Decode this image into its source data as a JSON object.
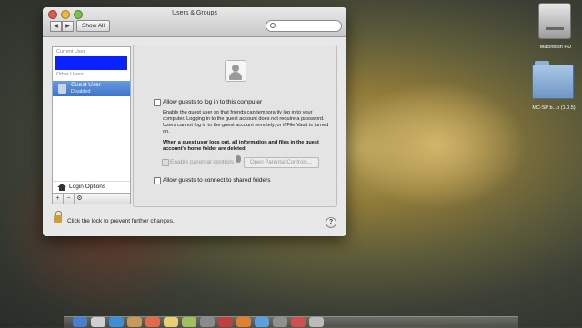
{
  "window": {
    "title": "Users & Groups",
    "show_all": "Show All",
    "search_placeholder": ""
  },
  "sidebar": {
    "current_user_header": "Current User",
    "other_users_header": "Other Users",
    "guest_user": {
      "name": "Guest User",
      "status": "Disabled"
    },
    "login_options": "Login Options",
    "add_symbol": "+",
    "remove_symbol": "−",
    "action_symbol": "⚙"
  },
  "pane": {
    "allow_guests_label": "Allow guests to log in to this computer",
    "description": "Enable the guest user so that friends can temporarily log in to your computer. Logging in to the guest account does not require a password. Users cannot log in to the guest account remotely, or if File Vault is turned on.",
    "warning": "When a guest user logs out, all information and files in the guest account's home folder are deleted.",
    "parental_controls_label": "Enable parental controls",
    "open_parental_controls": "Open Parental Controls…",
    "shared_folders_label": "Allow guests to connect to shared folders"
  },
  "footer": {
    "lock_text": "Click the lock to prevent further changes.",
    "help": "?"
  },
  "desktop": {
    "hd_label": "Macintosh HD",
    "folder_label": "MC-SP b...b (1.0.5)"
  },
  "colors": {
    "selection": "#3d73c9",
    "redaction": "#0a22ff"
  }
}
